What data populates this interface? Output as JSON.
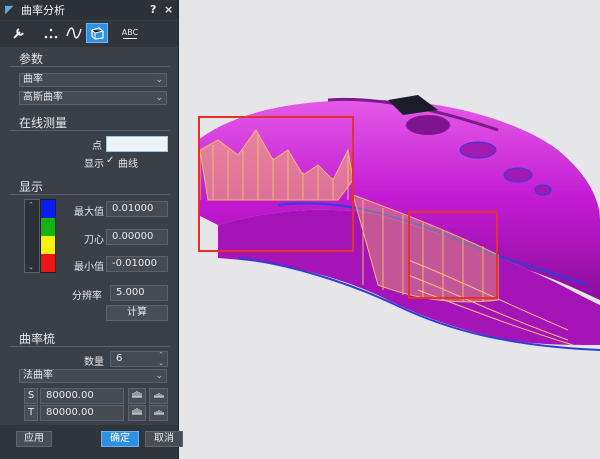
{
  "window": {
    "title": "曲率分析",
    "help": "?",
    "close": "×"
  },
  "toolbar": {
    "text_tool": "ABC"
  },
  "params": {
    "title": "参数",
    "type_value": "曲率",
    "mode_value": "高斯曲率"
  },
  "measure": {
    "title": "在线测量",
    "point_label": "点",
    "point_value": "",
    "show_label": "显示",
    "curve_check": "✓",
    "curve_label": "曲线"
  },
  "display": {
    "title": "显示",
    "max_label": "最大值",
    "max_value": "0.01000",
    "knife_label": "刀心",
    "knife_value": "0.00000",
    "min_label": "最小值",
    "min_value": "-0.01000",
    "res_label": "分辨率",
    "res_value": "5.000",
    "compute_label": "计算",
    "legend_colors": [
      "#0b1cf0",
      "#12b512",
      "#f7f20c",
      "#ee1515"
    ]
  },
  "comb": {
    "title": "曲率梳",
    "count_label": "数量",
    "count_value": "6",
    "mode_value": "法曲率",
    "s_label": "S",
    "s_value": "80000.00",
    "t_label": "T",
    "t_value": "80000.00"
  },
  "footer": {
    "apply": "应用",
    "ok": "确定",
    "cancel": "取消"
  },
  "colors": {
    "panel": "#3a4048",
    "accent": "#2f8fe0",
    "model": "#c218d4",
    "comb": "#f2b86a",
    "highlight": "#e5302e"
  }
}
